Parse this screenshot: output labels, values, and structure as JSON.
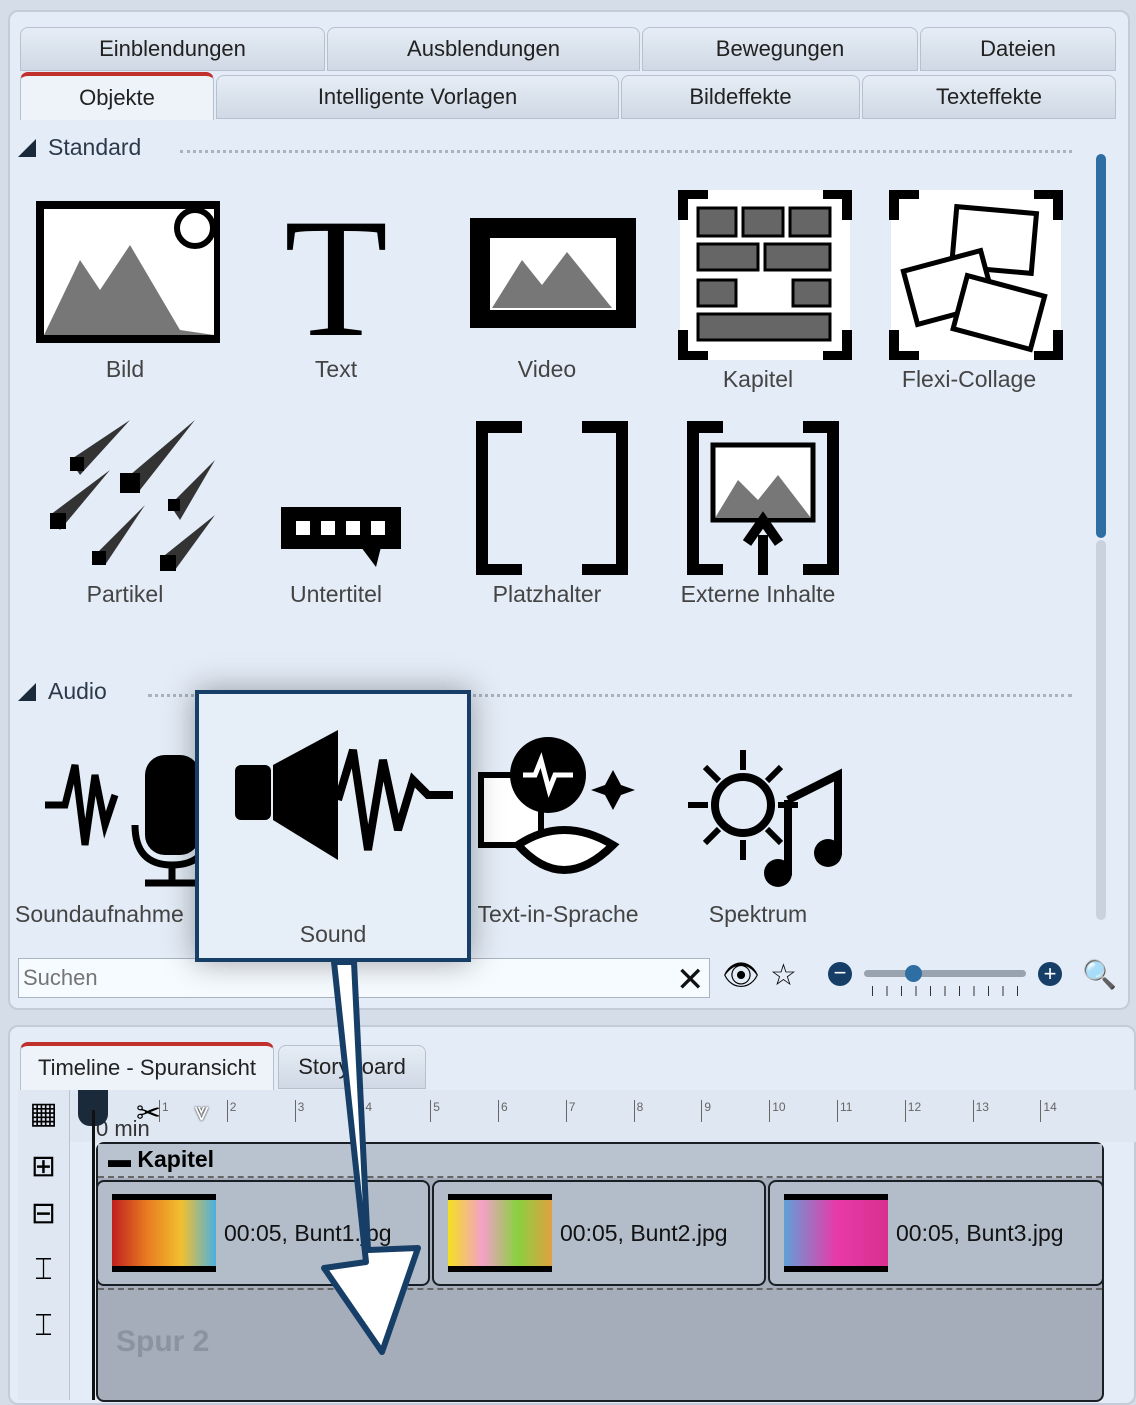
{
  "tabs_row1": [
    "Einblendungen",
    "Ausblendungen",
    "Bewegungen",
    "Dateien"
  ],
  "tabs_row2": [
    "Objekte",
    "Intelligente Vorlagen",
    "Bildeffekte",
    "Texteffekte"
  ],
  "active_tab": "Objekte",
  "sections": {
    "standard": "Standard",
    "audio": "Audio"
  },
  "standard_items": [
    "Bild",
    "Text",
    "Video",
    "Kapitel",
    "Flexi-Collage",
    "Partikel",
    "Untertitel",
    "Platzhalter",
    "Externe Inhalte"
  ],
  "audio_items": [
    "Soundaufnahme",
    "Sound",
    "Text-in-Sprache",
    "Spektrum"
  ],
  "search": {
    "placeholder": "Suchen"
  },
  "zoom_slider": {
    "value": 0.3
  },
  "accent": "#2f6ea3",
  "timeline": {
    "tabs": [
      "Timeline - Spuransicht",
      "Storyboard"
    ],
    "ruler_unit": "0 min",
    "ruler_ticks": [
      "1",
      "2",
      "3",
      "4",
      "5",
      "6",
      "7",
      "8",
      "9",
      "10",
      "11",
      "12",
      "13",
      "14"
    ],
    "chapter": "Kapitel",
    "clips": [
      {
        "label": "00:05, Bunt1.jpg"
      },
      {
        "label": "00:05, Bunt2.jpg"
      },
      {
        "label": "00:05, Bunt3.jpg"
      }
    ],
    "track2": "Spur 2"
  },
  "drag_tooltip": "Sound"
}
